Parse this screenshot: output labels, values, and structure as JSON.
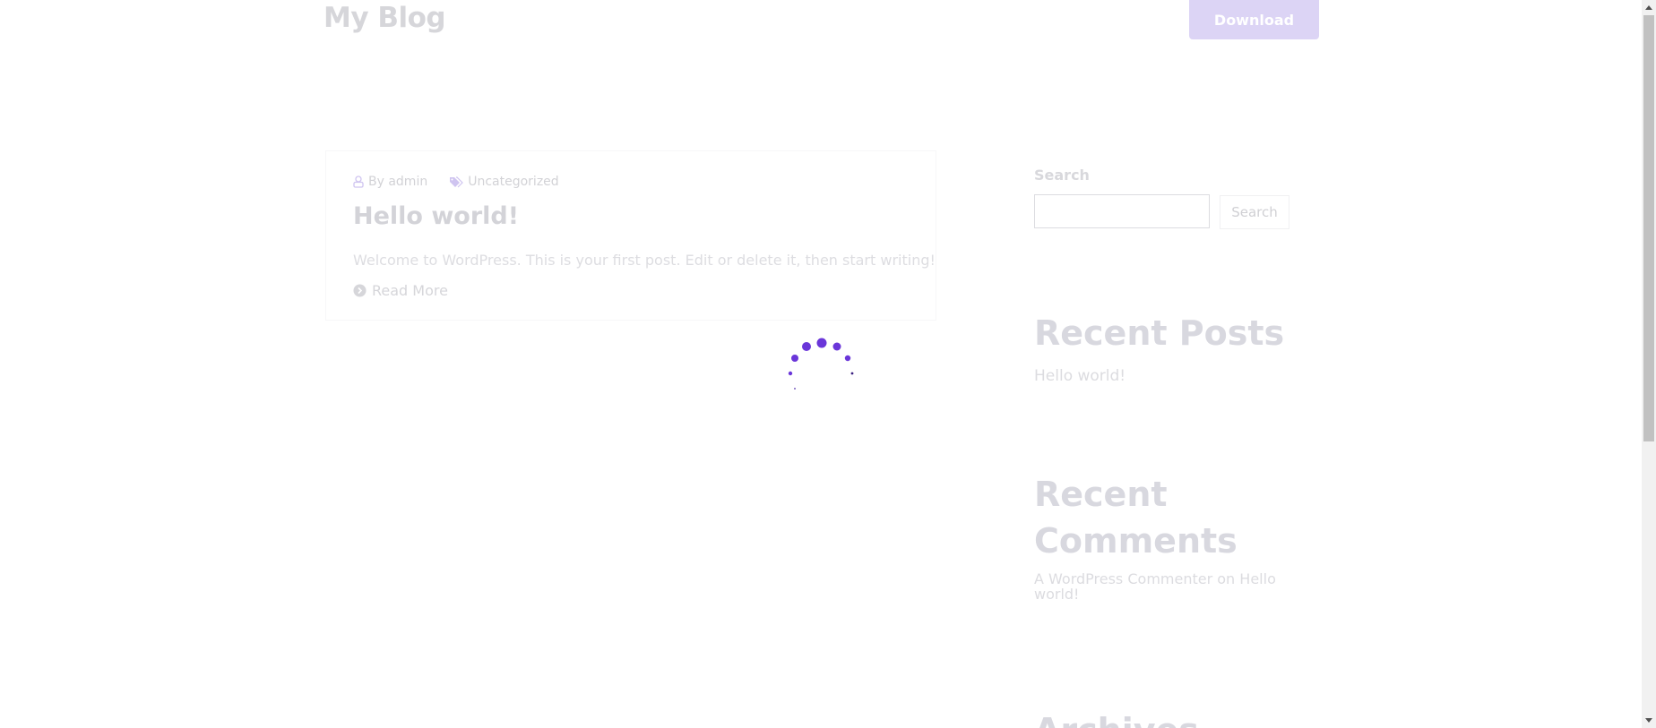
{
  "header": {
    "site_title": "My Blog",
    "download_label": "Download"
  },
  "post": {
    "author_meta": "By admin",
    "category": "Uncategorized",
    "title": "Hello world!",
    "excerpt": "Welcome to WordPress. This is your first post. Edit or delete it, then start writing!",
    "read_more": "Read More"
  },
  "sidebar": {
    "search_label": "Search",
    "search_value": "",
    "search_button": "Search",
    "recent_posts_heading": "Recent Posts",
    "recent_posts": [
      "Hello world!"
    ],
    "recent_comments_heading": "Recent Comments",
    "comment_author": "A WordPress Commenter",
    "comment_on": "on",
    "comment_post": "Hello world!",
    "archives_heading": "Archives"
  },
  "loader": {
    "accent_color": "#6a36d9"
  },
  "colors": {
    "brand_button": "#dcd4f5",
    "spinner": "#6a36d9"
  },
  "icons": {
    "author": "user-icon",
    "category": "tags-icon",
    "read_more": "chevron-circle-right-icon",
    "loader": "spinner-icon"
  }
}
